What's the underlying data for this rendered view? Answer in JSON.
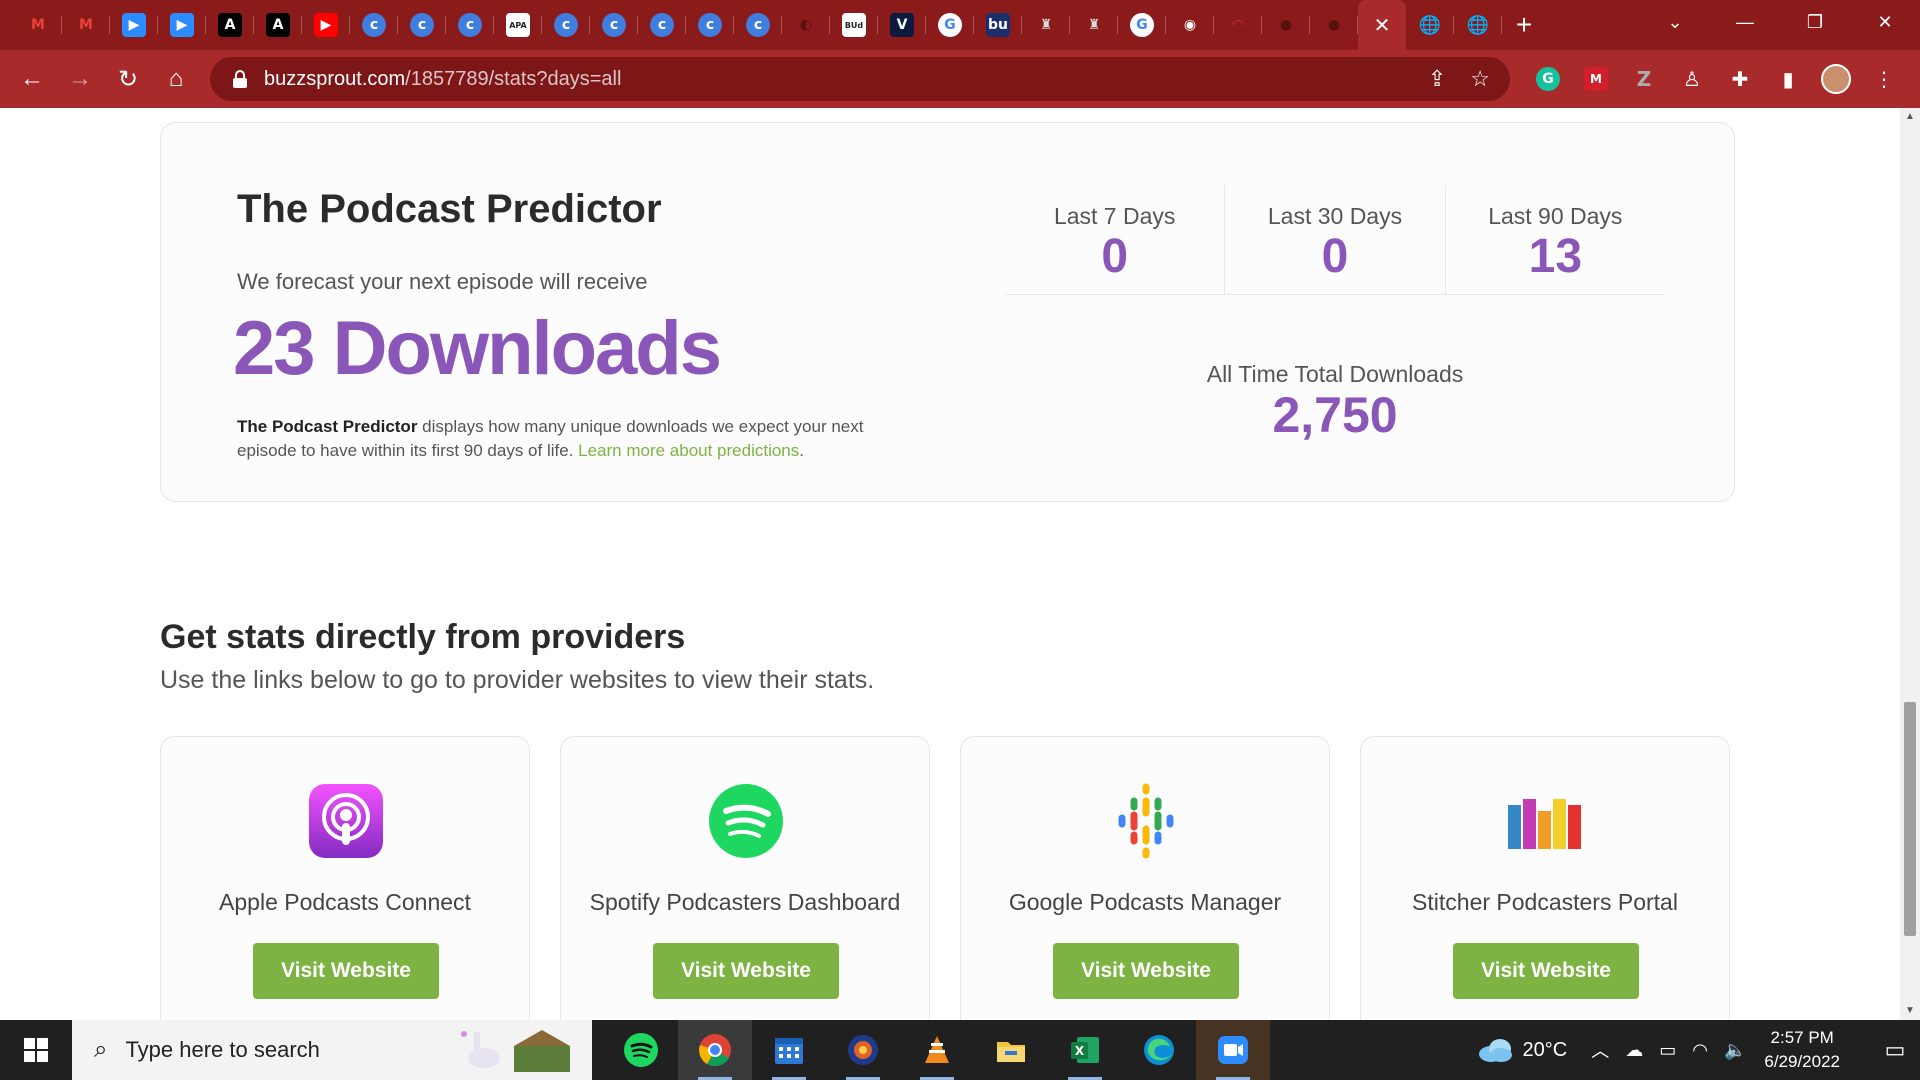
{
  "browser": {
    "url_host": "buzzsprout.com",
    "url_path": "/1857789/stats?days=all",
    "tabs": [
      {
        "icon": "gmail-icon",
        "glyph": "M",
        "bg": "transparent",
        "fg": "#ea4335"
      },
      {
        "icon": "gmail-icon",
        "glyph": "M",
        "bg": "transparent",
        "fg": "#ea4335"
      },
      {
        "icon": "zoom-icon",
        "glyph": "▶",
        "bg": "#2d8cff",
        "fg": "#ffffff"
      },
      {
        "icon": "zoom-icon",
        "glyph": "▶",
        "bg": "#2d8cff",
        "fg": "#ffffff"
      },
      {
        "icon": "font-a-icon",
        "glyph": "A",
        "bg": "#000000",
        "fg": "#ffffff"
      },
      {
        "icon": "font-a-icon",
        "glyph": "A",
        "bg": "#000000",
        "fg": "#ffffff"
      },
      {
        "icon": "youtube-icon",
        "glyph": "▶",
        "bg": "#ff0000",
        "fg": "#ffffff"
      },
      {
        "icon": "c-circle-icon",
        "glyph": "c",
        "bg": "#3f7de0",
        "fg": "#ffffff"
      },
      {
        "icon": "c-circle-icon",
        "glyph": "c",
        "bg": "#3f7de0",
        "fg": "#ffffff"
      },
      {
        "icon": "c-circle-icon",
        "glyph": "c",
        "bg": "#3f7de0",
        "fg": "#ffffff"
      },
      {
        "icon": "apa-icon",
        "glyph": "APA",
        "bg": "#ffffff",
        "fg": "#222222"
      },
      {
        "icon": "c-circle-icon",
        "glyph": "c",
        "bg": "#3f7de0",
        "fg": "#ffffff"
      },
      {
        "icon": "c-circle-icon",
        "glyph": "c",
        "bg": "#3f7de0",
        "fg": "#ffffff"
      },
      {
        "icon": "c-circle-icon",
        "glyph": "c",
        "bg": "#3f7de0",
        "fg": "#ffffff"
      },
      {
        "icon": "c-circle-icon",
        "glyph": "c",
        "bg": "#3f7de0",
        "fg": "#ffffff"
      },
      {
        "icon": "c-circle-icon",
        "glyph": "c",
        "bg": "#3f7de0",
        "fg": "#ffffff"
      },
      {
        "icon": "loading-icon",
        "glyph": "◐",
        "bg": "transparent",
        "fg": "#5a1010"
      },
      {
        "icon": "bud-icon",
        "glyph": "BUd",
        "bg": "#ffffff",
        "fg": "#222222"
      },
      {
        "icon": "v-icon",
        "glyph": "V",
        "bg": "#0d1b3e",
        "fg": "#ffffff"
      },
      {
        "icon": "google-icon",
        "glyph": "G",
        "bg": "#ffffff",
        "fg": "#4285f4"
      },
      {
        "icon": "bu-icon",
        "glyph": "bu",
        "bg": "#1c2f6b",
        "fg": "#ffffff"
      },
      {
        "icon": "crest-icon",
        "glyph": "♜",
        "bg": "transparent",
        "fg": "#dddddd"
      },
      {
        "icon": "crest-icon",
        "glyph": "♜",
        "bg": "transparent",
        "fg": "#dddddd"
      },
      {
        "icon": "google-icon",
        "glyph": "G",
        "bg": "#ffffff",
        "fg": "#4285f4"
      },
      {
        "icon": "chrome-icon",
        "glyph": "◉",
        "bg": "transparent",
        "fg": "#ffffff"
      },
      {
        "icon": "gauge-icon",
        "glyph": "◠",
        "bg": "transparent",
        "fg": "#e03030"
      },
      {
        "icon": "github-icon",
        "glyph": "●",
        "bg": "transparent",
        "fg": "#5a1010"
      },
      {
        "icon": "github-icon",
        "glyph": "●",
        "bg": "transparent",
        "fg": "#5a1010"
      }
    ],
    "active_tab_close": "✕",
    "after_active": [
      {
        "icon": "globe-icon",
        "glyph": "🌐"
      },
      {
        "icon": "globe-icon",
        "glyph": "🌐"
      }
    ],
    "new_tab": "+",
    "window_controls": [
      "⌄",
      "—",
      "❐",
      "✕"
    ]
  },
  "predictor": {
    "title": "The Podcast Predictor",
    "subtitle": "We forecast your next episode will receive",
    "forecast": "23 Downloads",
    "desc_bold": "The Podcast Predictor",
    "desc_text": " displays how many unique downloads we expect your next episode to have within its first 90 days of life. ",
    "desc_link": "Learn more about predictions",
    "desc_end": "."
  },
  "stats": {
    "last7_label": "Last 7 Days",
    "last7_value": "0",
    "last30_label": "Last 30 Days",
    "last30_value": "0",
    "last90_label": "Last 90 Days",
    "last90_value": "13",
    "alltime_label": "All Time Total Downloads",
    "alltime_value": "2,750"
  },
  "providers": {
    "title": "Get stats directly from providers",
    "subtitle": "Use the links below to go to provider websites to view their stats.",
    "cards": [
      {
        "name": "Apple Podcasts Connect",
        "button": "Visit Website"
      },
      {
        "name": "Spotify Podcasters Dashboard",
        "button": "Visit Website"
      },
      {
        "name": "Google Podcasts Manager",
        "button": "Visit Website"
      },
      {
        "name": "Stitcher Podcasters Portal",
        "button": "Visit Website"
      }
    ]
  },
  "colors": {
    "accent_purple": "#8a56b8",
    "button_green": "#7cb342",
    "browser_red": "#a82a2a"
  },
  "taskbar": {
    "search_placeholder": "Type here to search",
    "weather": "20°C",
    "time": "2:57 PM",
    "date": "6/29/2022"
  }
}
